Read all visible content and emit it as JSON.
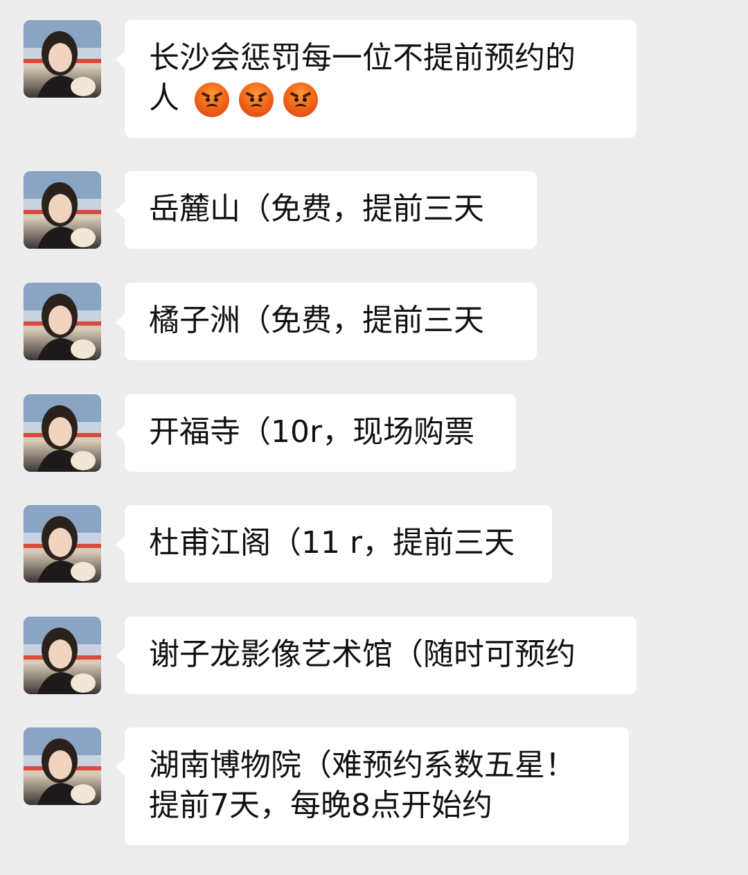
{
  "messages": [
    {
      "lines": [
        "长沙会惩罚每一位不提前预约的",
        "人"
      ],
      "trailing_emoji": [
        "angry-face",
        "angry-face",
        "angry-face"
      ]
    },
    {
      "lines": [
        "岳麓山（免费，提前三天"
      ]
    },
    {
      "lines": [
        "橘子洲（免费，提前三天"
      ]
    },
    {
      "lines": [
        "开福寺（10r，现场购票"
      ]
    },
    {
      "lines": [
        "杜甫江阁（11 r，提前三天"
      ]
    },
    {
      "lines": [
        "谢子龙影像艺术馆（随时可预约"
      ]
    },
    {
      "lines": [
        "湖南博物院（难预约系数五星！",
        "提前7天，每晚8点开始约"
      ]
    }
  ],
  "colors": {
    "background": "#ededed",
    "bubble": "#ffffff",
    "text": "#111111",
    "emoji": "#f26a1b"
  }
}
